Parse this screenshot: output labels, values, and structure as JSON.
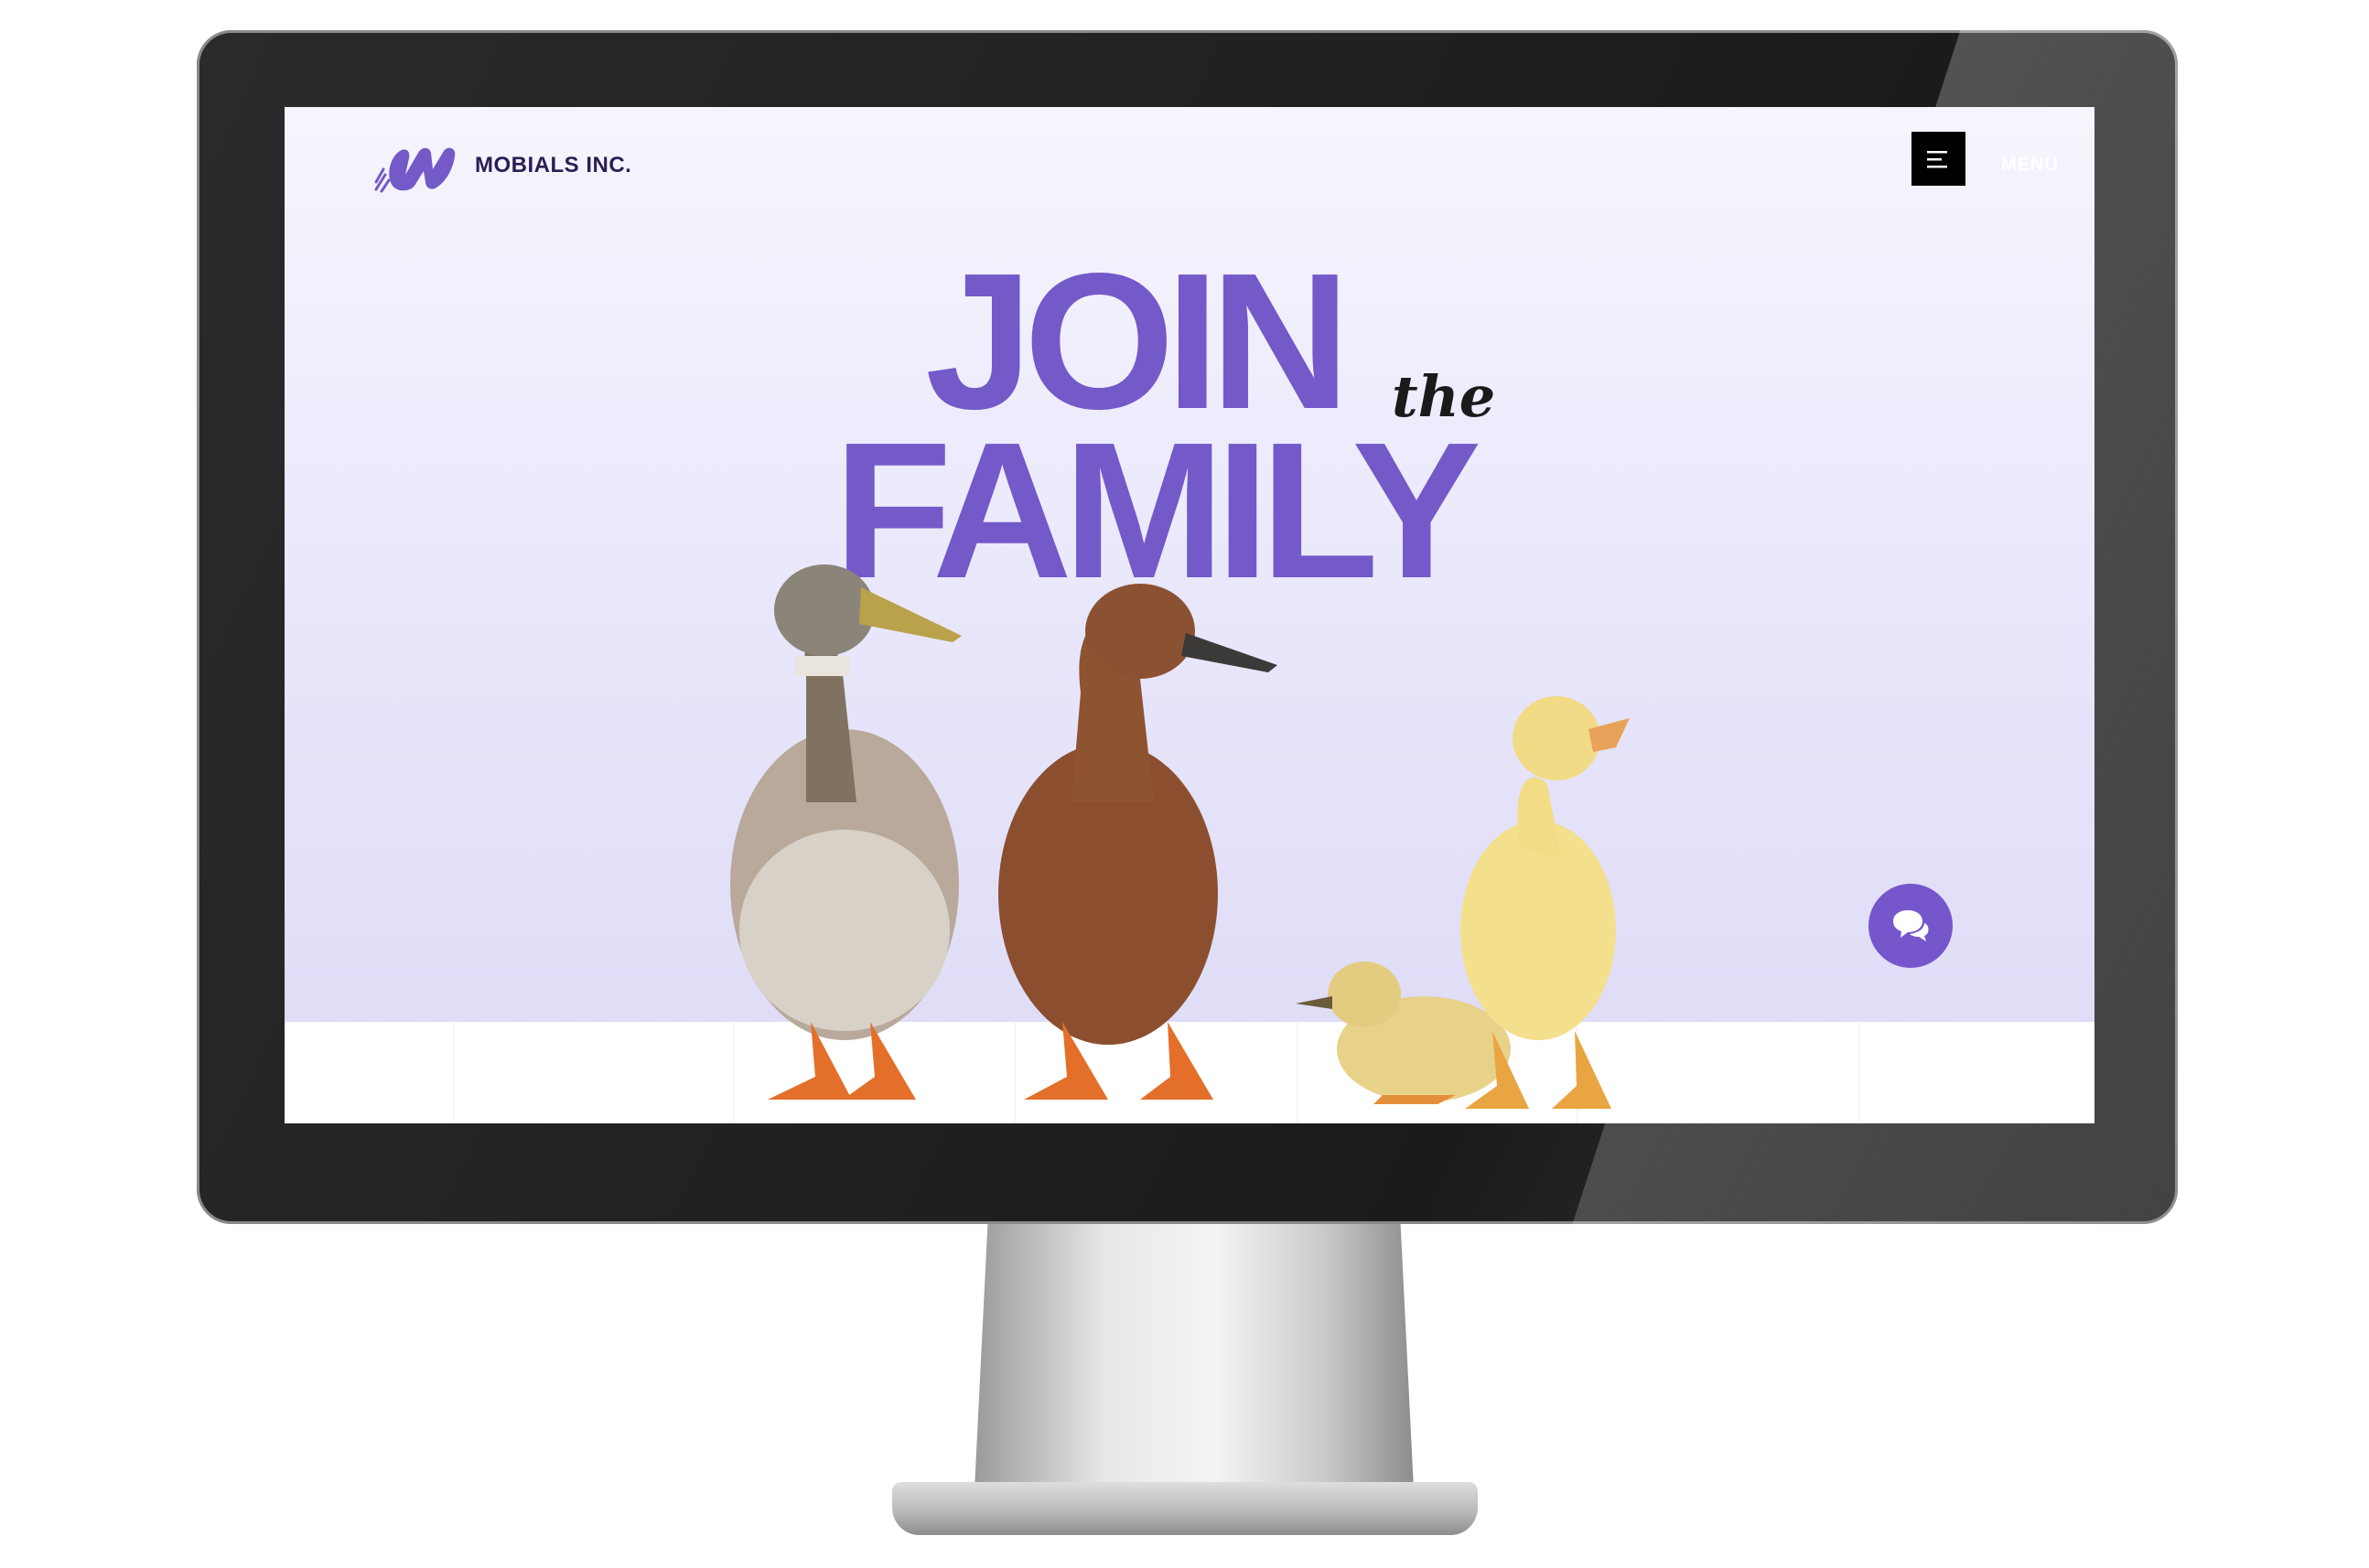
{
  "site": {
    "brand_name": "MOBIALS INC.",
    "menu_label": "MENU",
    "headline_line1": "JOIN",
    "headline_connector": "the",
    "headline_line2": "FAMILY"
  },
  "colors": {
    "brand_purple": "#7459c9",
    "brand_dark": "#2c1d54",
    "menu_button": "#000000"
  },
  "icons": {
    "menu": "hamburger-menu-icon",
    "chat": "chat-bubbles-icon",
    "logo": "mobials-logo-icon"
  }
}
